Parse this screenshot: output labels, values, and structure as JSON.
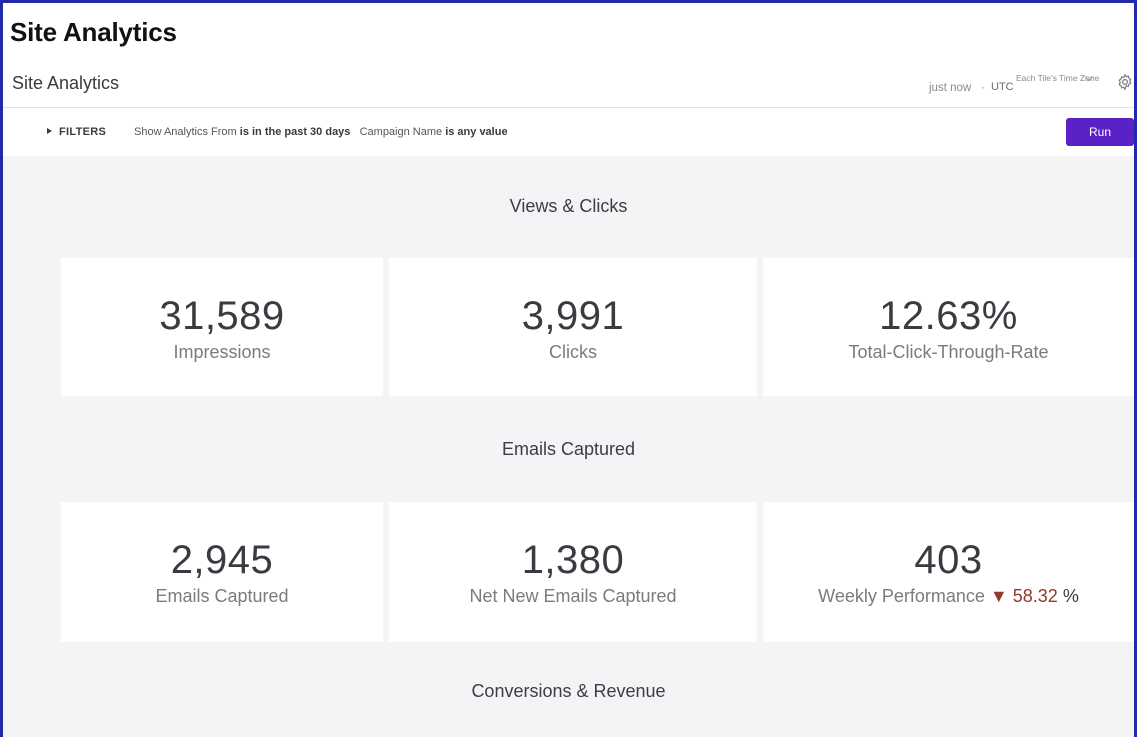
{
  "app": {
    "title": "Site Analytics"
  },
  "header": {
    "page_title": "Site Analytics",
    "refreshed": "just now",
    "separator": "·",
    "timezone_label": "Each Tile's Time Zone",
    "timezone_value": "UTC",
    "settings_icon": "gear-icon"
  },
  "filters": {
    "toggle_label": "FILTERS",
    "items": [
      {
        "field": "Show Analytics From",
        "condition": "is in the past 30 days"
      },
      {
        "field": "Campaign Name",
        "condition": "is any value"
      }
    ],
    "run_label": "Run"
  },
  "sections": [
    {
      "title": "Views & Clicks",
      "tiles": [
        {
          "value": "31,589",
          "label": "Impressions"
        },
        {
          "value": "3,991",
          "label": "Clicks"
        },
        {
          "value": "12.63%",
          "label": "Total-Click-Through-Rate"
        }
      ]
    },
    {
      "title": "Emails Captured",
      "tiles": [
        {
          "value": "2,945",
          "label": "Emails Captured"
        },
        {
          "value": "1,380",
          "label": "Net New Emails Captured"
        },
        {
          "value": "403",
          "label": "Weekly Performance",
          "delta_symbol": "▼",
          "delta_value": "58.32",
          "delta_unit": "%"
        }
      ]
    },
    {
      "title": "Conversions & Revenue",
      "tiles": []
    }
  ],
  "colors": {
    "accent": "#5a21c6",
    "frame_border": "#2229a8",
    "negative": "#8e3b2c",
    "background": "#f4f4f6"
  }
}
